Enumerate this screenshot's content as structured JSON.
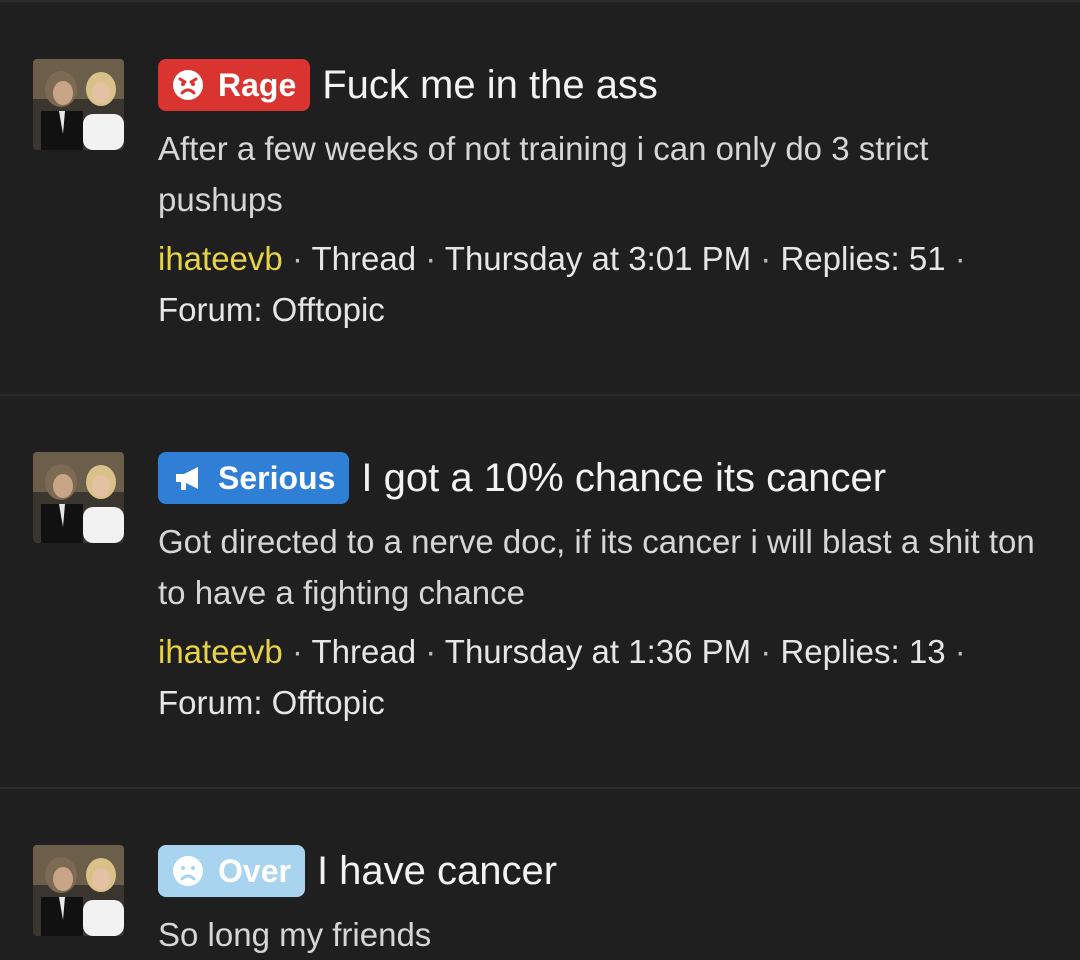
{
  "colors": {
    "background": "#1f1f1f",
    "author": "#e7d24a",
    "rage_prefix": "#d9342f",
    "serious_prefix": "#2f7fd6",
    "over_prefix": "#a9d4f0"
  },
  "threads": [
    {
      "prefix": {
        "label": "Rage",
        "icon": "angry-face-icon"
      },
      "title": "Fuck me in the ass",
      "snippet": "After a few weeks of not training i can only do 3 strict pushups",
      "meta": {
        "author": "ihateevb",
        "type": "Thread",
        "date": "Thursday at 3:01 PM",
        "replies": "Replies: 51",
        "forum": "Forum: Offtopic"
      }
    },
    {
      "prefix": {
        "label": "Serious",
        "icon": "megaphone-icon"
      },
      "title": "I got a 10% chance its cancer",
      "snippet": "Got directed to a nerve doc, if its cancer i will blast a shit ton to have a fighting chance",
      "meta": {
        "author": "ihateevb",
        "type": "Thread",
        "date": "Thursday at 1:36 PM",
        "replies": "Replies: 13",
        "forum": "Forum: Offtopic"
      }
    },
    {
      "prefix": {
        "label": "Over",
        "icon": "sad-face-icon"
      },
      "title": "I have cancer",
      "snippet": "So long my friends"
    }
  ]
}
